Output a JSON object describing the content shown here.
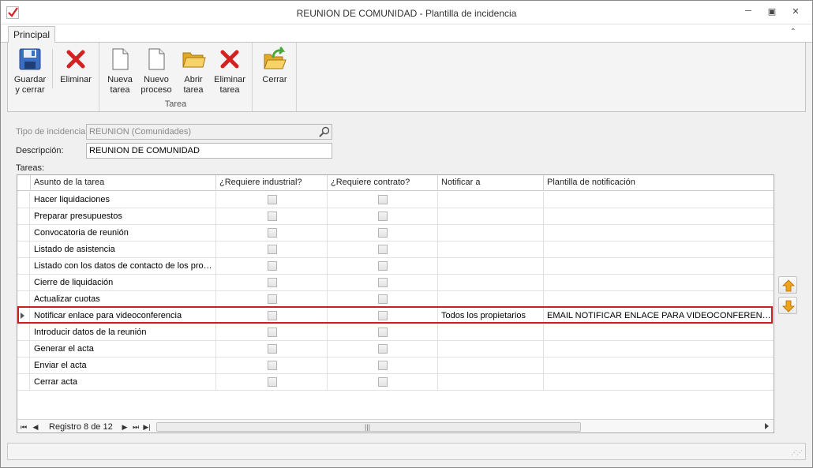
{
  "window": {
    "title": "REUNION DE COMUNIDAD - Plantilla de incidencia",
    "minimize": "─",
    "restore": "▣",
    "close": "✕"
  },
  "ribbon": {
    "tab": "Principal",
    "collapse": "⌃",
    "buttons": {
      "save_close": [
        "Guardar",
        "y cerrar"
      ],
      "delete": [
        "Eliminar"
      ],
      "new_task": [
        "Nueva",
        "tarea"
      ],
      "new_process": [
        "Nuevo",
        "proceso"
      ],
      "open_task": [
        "Abrir",
        "tarea"
      ],
      "delete_task": [
        "Eliminar",
        "tarea"
      ],
      "close": [
        "Cerrar"
      ]
    },
    "group_tarea": "Tarea",
    "icon_colors": {
      "delete_red": "#d32222",
      "folder_yellow": "#f2c23a",
      "arrow_green": "#49a83b"
    }
  },
  "form": {
    "tipo_label": "Tipo de incidencia",
    "tipo_value": "REUNION (Comunidades)",
    "descripcion_label": "Descripción:",
    "descripcion_value": "REUNION DE COMUNIDAD",
    "tareas_label": "Tareas:"
  },
  "grid": {
    "columns": [
      "Asunto de la tarea",
      "¿Requiere industrial?",
      "¿Requiere contrato?",
      "Notificar a",
      "Plantilla de notificación"
    ],
    "rows": [
      {
        "asunto": "Hacer liquidaciones",
        "industrial": false,
        "contrato": false,
        "notificar": "",
        "plantilla": ""
      },
      {
        "asunto": "Preparar presupuestos",
        "industrial": false,
        "contrato": false,
        "notificar": "",
        "plantilla": ""
      },
      {
        "asunto": "Convocatoria de reunión",
        "industrial": false,
        "contrato": false,
        "notificar": "",
        "plantilla": ""
      },
      {
        "asunto": "Listado de asistencia",
        "industrial": false,
        "contrato": false,
        "notificar": "",
        "plantilla": ""
      },
      {
        "asunto": "Listado con los datos de contacto de los propi...",
        "industrial": false,
        "contrato": false,
        "notificar": "",
        "plantilla": ""
      },
      {
        "asunto": "Cierre de liquidación",
        "industrial": false,
        "contrato": false,
        "notificar": "",
        "plantilla": ""
      },
      {
        "asunto": "Actualizar cuotas",
        "industrial": false,
        "contrato": false,
        "notificar": "",
        "plantilla": ""
      },
      {
        "asunto": "Notificar enlace para videoconferencia",
        "industrial": false,
        "contrato": false,
        "notificar": "Todos los propietarios",
        "plantilla": "EMAIL NOTIFICAR ENLACE PARA VIDEOCONFERENCIA",
        "selected": true
      },
      {
        "asunto": "Introducir datos de la reunión",
        "industrial": false,
        "contrato": false,
        "notificar": "",
        "plantilla": ""
      },
      {
        "asunto": "Generar el acta",
        "industrial": false,
        "contrato": false,
        "notificar": "",
        "plantilla": ""
      },
      {
        "asunto": "Enviar el acta",
        "industrial": false,
        "contrato": false,
        "notificar": "",
        "plantilla": ""
      },
      {
        "asunto": "Cerrar acta",
        "industrial": false,
        "contrato": false,
        "notificar": "",
        "plantilla": ""
      }
    ],
    "navigator": {
      "first": "⏮",
      "prev": "◀",
      "record_text": "Registro 8 de 12",
      "next": "▶",
      "last": "⏭",
      "end": "▶|"
    },
    "selection_color": "#cc1f1f"
  }
}
